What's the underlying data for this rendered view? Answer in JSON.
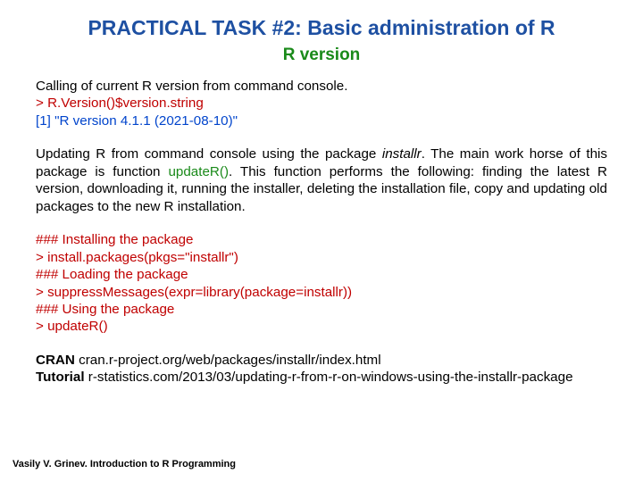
{
  "title": "PRACTICAL TASK #2: Basic administration of R",
  "subtitle": "R version",
  "p1": "Calling of current R version from command console.",
  "code1": "> R.Version()$version.string",
  "out1": "[1] \"R version 4.1.1 (2021-08-10)\"",
  "p2a": "Updating R from command console using the package ",
  "p2_pkg": "installr",
  "p2b": ". The main work horse of this package is function ",
  "p2_fn": "updateR()",
  "p2c": ". This function performs the following: finding the latest R version, downloading it, running the installer, deleting the installation file, copy and updating old packages to the new R installation.",
  "h_install": "### Installing the package",
  "code_install": "> install.packages(pkgs=\"installr\")",
  "h_load": "### Loading the package",
  "code_load": "> suppressMessages(expr=library(package=installr))",
  "h_use": "### Using the package",
  "code_use": "> updateR()",
  "cran_label": "CRAN",
  "cran_url": " cran.r-project.org/web/packages/installr/index.html",
  "tut_label": "Tutorial",
  "tut_url": " r-statistics.com/2013/03/updating-r-from-r-on-windows-using-the-installr-package",
  "footer": "Vasily V. Grinev. Introduction to R Programming"
}
